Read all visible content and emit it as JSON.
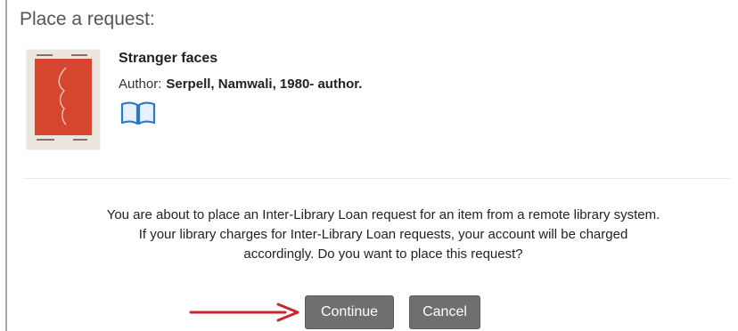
{
  "panel": {
    "title": "Place a request:"
  },
  "item": {
    "title": "Stranger faces",
    "author_label": "Author:",
    "author_value": "Serpell, Namwali, 1980- author.",
    "format_icon": "book-icon"
  },
  "message": {
    "line1": "You are about to place an Inter-Library Loan request for an item from a remote library system.",
    "line2": "If your library charges for Inter-Library Loan requests, your account will be charged",
    "line3": "accordingly. Do you want to place this request?"
  },
  "actions": {
    "continue_label": "Continue",
    "cancel_label": "Cancel"
  },
  "annotation": {
    "arrow_icon": "arrow-right-icon",
    "arrow_color": "#c8262c"
  },
  "colors": {
    "button_bg": "#6f6f6f",
    "cover_red": "#d6462f"
  }
}
